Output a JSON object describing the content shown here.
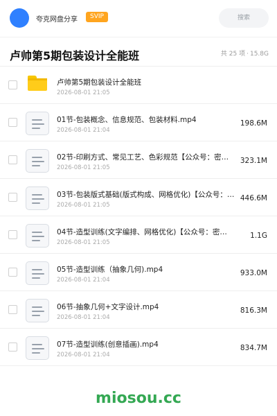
{
  "header": {
    "brand": "夸克网盘分享",
    "badge": "SVIP",
    "search_placeholder": "搜索"
  },
  "share": {
    "title": "卢帅第5期包装设计全能班",
    "count": "共 25 项",
    "separator": "·",
    "size": "15.8G"
  },
  "items": [
    {
      "type": "folder",
      "name": "卢帅第5期包装设计全能班",
      "date": "2026-08-01 21:05",
      "size": ""
    },
    {
      "type": "file",
      "name": "01节-包装概念、信息规范、包装材料.mp4",
      "date": "2026-08-01 21:04",
      "size": "198.6M"
    },
    {
      "type": "file",
      "name": "02节-印刷方式、常见工艺、色彩规范【公众号：密知…",
      "date": "2026-08-01 21:05",
      "size": "323.1M"
    },
    {
      "type": "file",
      "name": "03节-包装版式基础(版式构成、网格优化)【公众号：…",
      "date": "2026-08-01 21:05",
      "size": "446.6M"
    },
    {
      "type": "file",
      "name": "04节-造型训练(文字编排、网格优化)【公众号：密…",
      "date": "2026-08-01 21:05",
      "size": "1.1G"
    },
    {
      "type": "file",
      "name": "05节-造型训练（抽象几何).mp4",
      "date": "2026-08-01 21:04",
      "size": "933.0M"
    },
    {
      "type": "file",
      "name": "06节-抽象几何+文字设计.mp4",
      "date": "2026-08-01 21:04",
      "size": "816.3M"
    },
    {
      "type": "file",
      "name": "07节-造型训练(创意插画).mp4",
      "date": "2026-08-01 21:04",
      "size": "834.7M"
    }
  ],
  "watermark": "miosou.cc",
  "colors": {
    "brand_blue": "#2f80ff",
    "svip_orange": "#ffa51f",
    "folder_yellow": "#ffcc1a",
    "watermark_green": "#34a853"
  },
  "icons": {
    "folder": "folder-icon",
    "file": "document-icon"
  }
}
